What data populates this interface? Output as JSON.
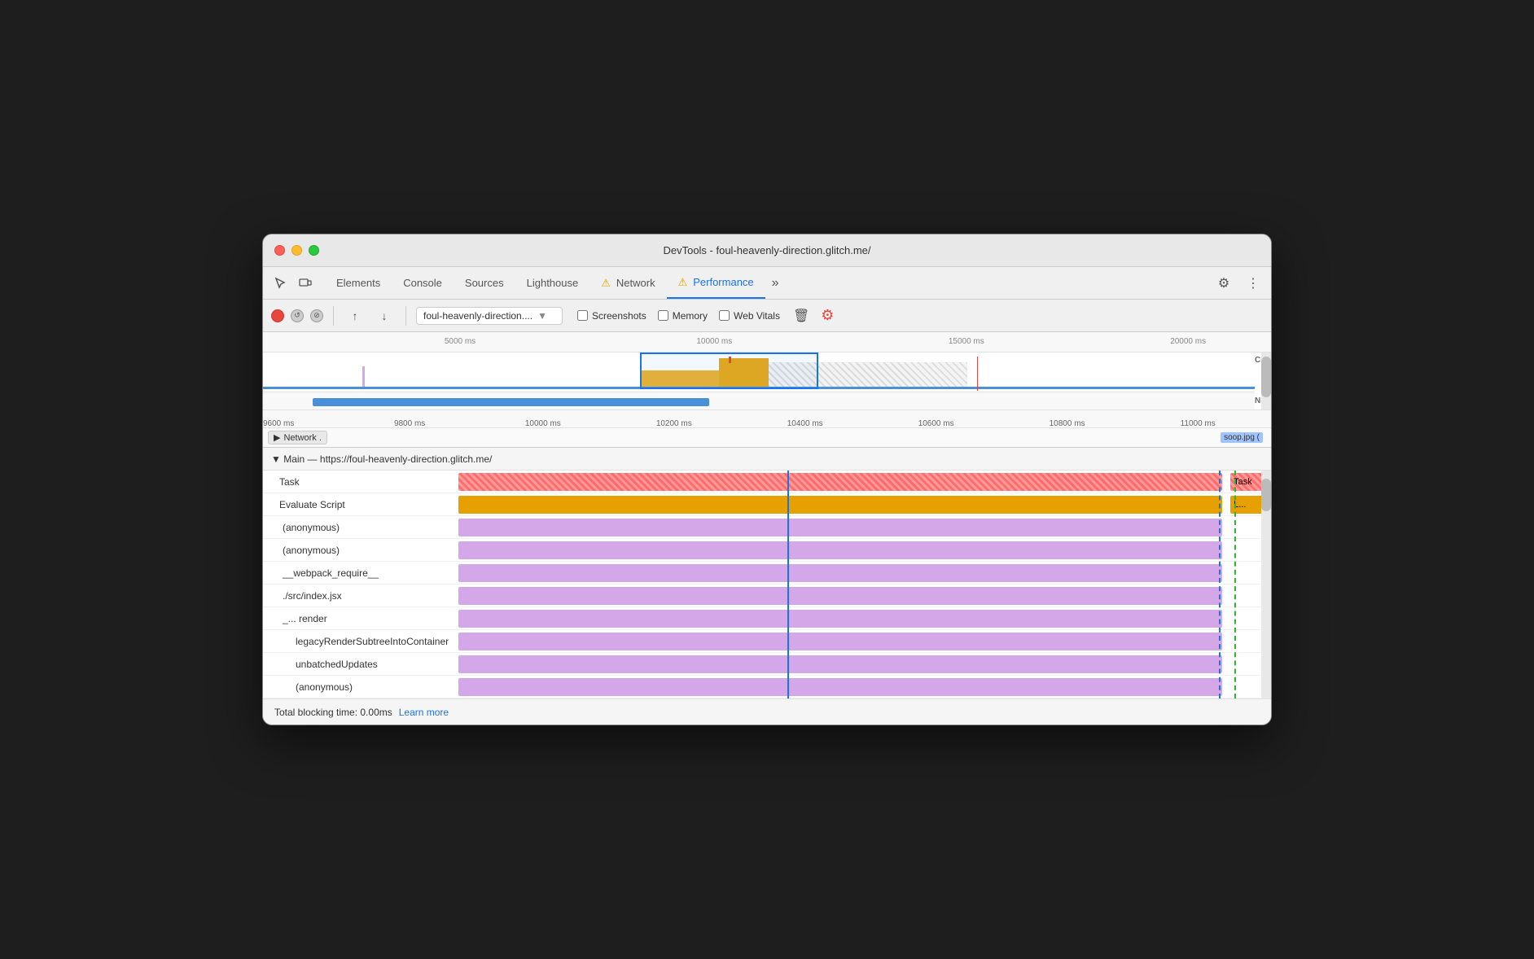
{
  "window": {
    "title": "DevTools - foul-heavenly-direction.glitch.me/"
  },
  "tabs": {
    "items": [
      {
        "label": "Elements",
        "active": false
      },
      {
        "label": "Console",
        "active": false
      },
      {
        "label": "Sources",
        "active": false
      },
      {
        "label": "Lighthouse",
        "active": false
      },
      {
        "label": "Network",
        "active": false,
        "warning": true
      },
      {
        "label": "Performance",
        "active": true,
        "warning": true
      }
    ],
    "more_label": "»"
  },
  "recordbar": {
    "url": "foul-heavenly-direction....",
    "screenshots_label": "Screenshots",
    "memory_label": "Memory",
    "web_vitals_label": "Web Vitals"
  },
  "timeline": {
    "ruler_marks": [
      "5000 ms",
      "10000 ms",
      "15000 ms",
      "20000 ms"
    ],
    "time_labels": [
      "9600 ms",
      "9800 ms",
      "10000 ms",
      "10200 ms",
      "10400 ms",
      "10600 ms",
      "10800 ms",
      "11000 ms"
    ],
    "cpu_label": "CPU",
    "net_label": "NET"
  },
  "network": {
    "label": "Network .",
    "thumb": "soop.jpg ("
  },
  "flame": {
    "header": "▼ Main — https://foul-heavenly-direction.glitch.me/",
    "rows": [
      {
        "label": "Task",
        "indent": 0,
        "bar_color": "task",
        "bar_text": "Task",
        "bar_right_text": "Task"
      },
      {
        "label": "Evaluate Script",
        "indent": 0,
        "bar_color": "evaluate",
        "bar_text": "",
        "bar_right_text": "L..."
      },
      {
        "label": "(anonymous)",
        "indent": 1,
        "bar_color": "purple",
        "bar_text": ""
      },
      {
        "label": "(anonymous)",
        "indent": 1,
        "bar_color": "purple",
        "bar_text": ""
      },
      {
        "label": "__webpack_require__",
        "indent": 1,
        "bar_color": "purple",
        "bar_text": ""
      },
      {
        "label": "./src/index.jsx",
        "indent": 1,
        "bar_color": "purple",
        "bar_text": ""
      },
      {
        "label": "_...  render",
        "indent": 1,
        "bar_color": "purple",
        "bar_text": ""
      },
      {
        "label": "legacyRenderSubtreeIntoContainer",
        "indent": 2,
        "bar_color": "purple",
        "bar_text": ""
      },
      {
        "label": "unbatchedUpdates",
        "indent": 2,
        "bar_color": "purple",
        "bar_text": ""
      },
      {
        "label": "(anonymous)",
        "indent": 2,
        "bar_color": "purple",
        "bar_text": ""
      }
    ]
  },
  "statusbar": {
    "tbt_text": "Total blocking time: 0.00ms",
    "learn_more": "Learn more"
  }
}
